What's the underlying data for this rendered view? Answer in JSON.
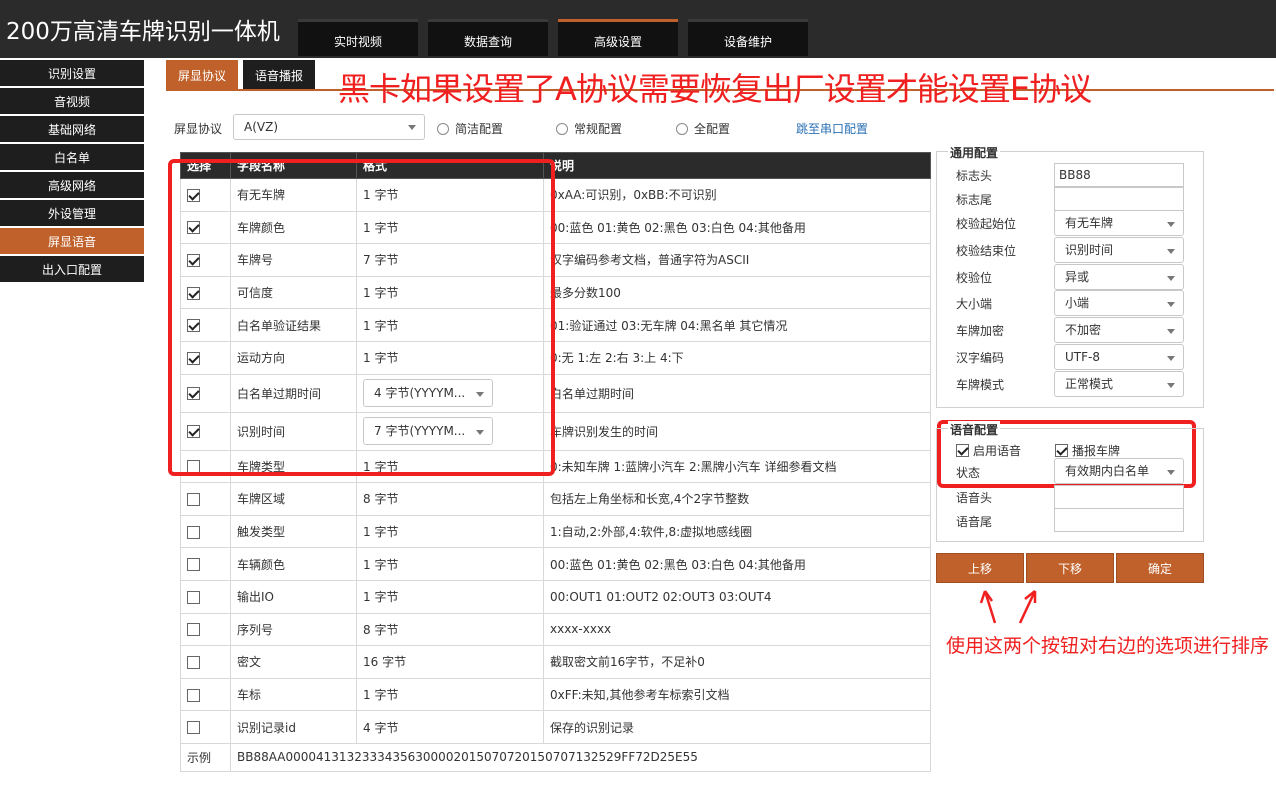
{
  "header": {
    "app_title": "200万高清车牌识别一体机",
    "tabs": [
      "实时视频",
      "数据查询",
      "高级设置",
      "设备维护"
    ]
  },
  "sidebar": {
    "items": [
      "识别设置",
      "音视频",
      "基础网络",
      "白名单",
      "高级网络",
      "外设管理",
      "屏显语音",
      "出入口配置"
    ]
  },
  "subtabs": [
    "屏显协议",
    "语音播报"
  ],
  "annotation": "黑卡如果设置了A协议需要恢复出厂设置才能设置E协议",
  "protocol": {
    "label": "屏显协议",
    "selected": "A(VZ)",
    "radios": [
      "简洁配置",
      "常规配置",
      "全配置"
    ],
    "link": "跳至串口配置"
  },
  "table": {
    "headers": [
      "选择",
      "字段名称",
      "格式",
      "说明"
    ],
    "rows": [
      {
        "checked": true,
        "name": "有无车牌",
        "format": "1 字节",
        "desc": "0xAA:可识别，0xBB:不可识别"
      },
      {
        "checked": true,
        "name": "车牌颜色",
        "format": "1 字节",
        "desc": "00:蓝色 01:黄色 02:黑色 03:白色 04:其他备用"
      },
      {
        "checked": true,
        "name": "车牌号",
        "format": "7 字节",
        "desc": "汉字编码参考文档，普通字符为ASCII"
      },
      {
        "checked": true,
        "name": "可信度",
        "format": "1 字节",
        "desc": "最多分数100"
      },
      {
        "checked": true,
        "name": "白名单验证结果",
        "format": "1 字节",
        "desc": "01:验证通过 03:无车牌 04:黑名单 其它情况"
      },
      {
        "checked": true,
        "name": "运动方向",
        "format": "1 字节",
        "desc": "0:无 1:左 2:右 3:上 4:下"
      },
      {
        "checked": true,
        "name": "白名单过期时间",
        "format": "4 字节(YYYYM...",
        "desc": "白名单过期时间"
      },
      {
        "checked": true,
        "name": "识别时间",
        "format": "7 字节(YYYYM...",
        "desc": "车牌识别发生的时间"
      },
      {
        "checked": false,
        "name": "车牌类型",
        "format": "1 字节",
        "desc": "0:未知车牌 1:蓝牌小汽车 2:黑牌小汽车 详细参看文档"
      },
      {
        "checked": false,
        "name": "车牌区域",
        "format": "8 字节",
        "desc": "包括左上角坐标和长宽,4个2字节整数"
      },
      {
        "checked": false,
        "name": "触发类型",
        "format": "1 字节",
        "desc": "1:自动,2:外部,4:软件,8:虚拟地感线圈"
      },
      {
        "checked": false,
        "name": "车辆颜色",
        "format": "1 字节",
        "desc": "00:蓝色 01:黄色 02:黑色 03:白色 04:其他备用"
      },
      {
        "checked": false,
        "name": "输出IO",
        "format": "1 字节",
        "desc": "00:OUT1 01:OUT2 02:OUT3 03:OUT4"
      },
      {
        "checked": false,
        "name": "序列号",
        "format": "8 字节",
        "desc": "xxxx-xxxx"
      },
      {
        "checked": false,
        "name": "密文",
        "format": "16 字节",
        "desc": "截取密文前16字节，不足补0"
      },
      {
        "checked": false,
        "name": "车标",
        "format": "1 字节",
        "desc": "0xFF:未知,其他参考车标索引文档"
      },
      {
        "checked": false,
        "name": "识别记录id",
        "format": "4 字节",
        "desc": "保存的识别记录"
      }
    ],
    "example_label": "示例",
    "example_value": "BB88AA00004131323334356300002015070720150707132529FF72D25E55"
  },
  "general_config": {
    "title": "通用配置",
    "fields": [
      {
        "label": "标志头",
        "value": "BB88",
        "kind": "input"
      },
      {
        "label": "标志尾",
        "value": "",
        "kind": "input"
      },
      {
        "label": "校验起始位",
        "value": "有无车牌",
        "kind": "select"
      },
      {
        "label": "校验结束位",
        "value": "识别时间",
        "kind": "select"
      },
      {
        "label": "校验位",
        "value": "异或",
        "kind": "select"
      },
      {
        "label": "大小端",
        "value": "小端",
        "kind": "select"
      },
      {
        "label": "车牌加密",
        "value": "不加密",
        "kind": "select"
      },
      {
        "label": "汉字编码",
        "value": "UTF-8",
        "kind": "select"
      },
      {
        "label": "车牌模式",
        "value": "正常模式",
        "kind": "select"
      }
    ]
  },
  "voice_config": {
    "title": "语音配置",
    "enable_voice": "启用语音",
    "broadcast_plate": "播报车牌",
    "status_label": "状态",
    "status_value": "有效期内白名单",
    "voice_head_label": "语音头",
    "voice_tail_label": "语音尾"
  },
  "buttons": {
    "up": "上移",
    "down": "下移",
    "confirm": "确定"
  },
  "note": "使用这两个按钮对右边的选项进行排序"
}
